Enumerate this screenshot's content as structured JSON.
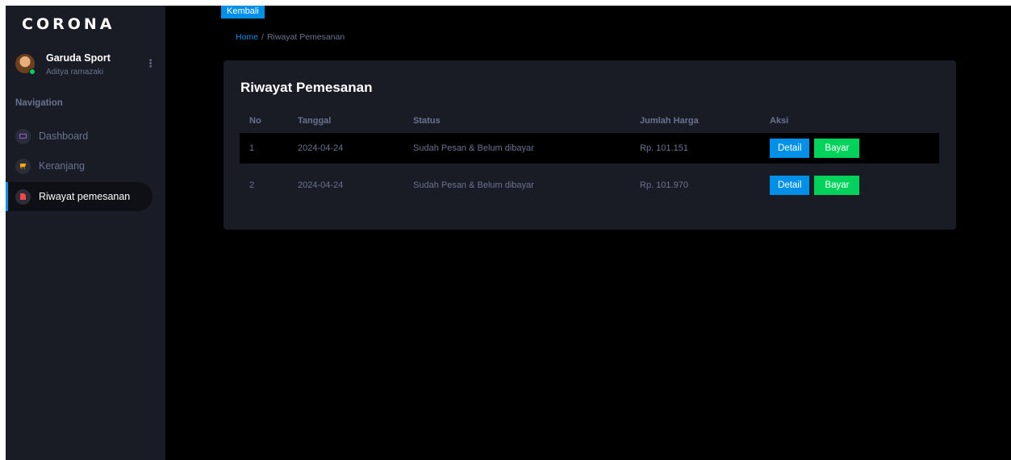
{
  "sidebar": {
    "brand": "CORONA",
    "profile": {
      "name": "Garuda Sport",
      "subtitle": "Aditya ramazaki",
      "status_color": "#00d25b"
    },
    "nav_heading": "Navigation",
    "items": [
      {
        "label": "Dashboard",
        "icon": "monitor-icon",
        "icon_color": "#8f5fe8",
        "active": false
      },
      {
        "label": "Keranjang",
        "icon": "cart-icon",
        "icon_color": "#ffab00",
        "active": false
      },
      {
        "label": "Riwayat pemesanan",
        "icon": "document-icon",
        "icon_color": "#fc424a",
        "active": true
      }
    ]
  },
  "main": {
    "back_button": "Kembali",
    "breadcrumb": {
      "home": "Home",
      "separator": "/",
      "current": "Riwayat Pemesanan"
    },
    "card": {
      "title": "Riwayat Pemesanan",
      "columns": [
        "No",
        "Tanggal",
        "Status",
        "Jumlah Harga",
        "Aksi"
      ],
      "rows": [
        {
          "no": "1",
          "date": "2024-04-24",
          "status": "Sudah Pesan & Belum dibayar",
          "amount": "Rp. 101.151",
          "detail": "Detail",
          "pay": "Bayar"
        },
        {
          "no": "2",
          "date": "2024-04-24",
          "status": "Sudah Pesan & Belum dibayar",
          "amount": "Rp. 101.970",
          "detail": "Detail",
          "pay": "Bayar"
        }
      ]
    }
  },
  "colors": {
    "primary": "#0090e7",
    "success": "#00d25b",
    "sidebar_bg": "#191c24",
    "page_bg": "#000000",
    "muted_text": "#6c7293"
  }
}
